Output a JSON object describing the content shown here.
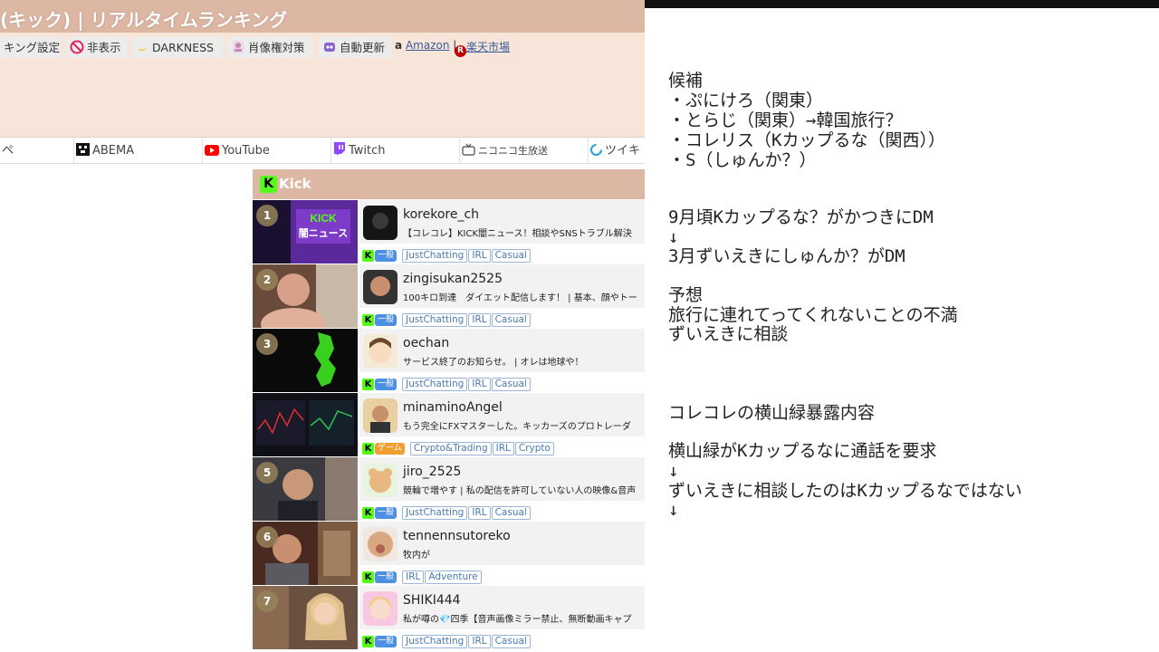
{
  "header": {
    "site_title": "(キック) | リアルタイムランキング"
  },
  "toolbar": {
    "ranking_settings": "キング設定",
    "hide": "非表示",
    "darkness": "DARKNESS",
    "portrait_rights": "肖像権対策",
    "auto_update": "自動更新",
    "amazon": "Amazon",
    "separator": "|",
    "rakuten": "楽天市場"
  },
  "platform_tabs": [
    "ペ",
    "ABEMA",
    "YouTube",
    "Twitch",
    "ニコニコ生放送",
    "ツイキ"
  ],
  "kick_panel": {
    "header_label": "Kick",
    "logo_letter": "K"
  },
  "ranking": [
    {
      "rank": "1",
      "username": "korekore_ch",
      "title": "【コレコレ】KICK闇ニュース！相談やSNSトラブル解決",
      "category": "一般",
      "category_color": "#4d8fe0",
      "tags": [
        "JustChatting",
        "IRL",
        "Casual"
      ]
    },
    {
      "rank": "2",
      "username": "zingisukan2525",
      "title": "100キロ到達　ダイエット配信します！ | 基本、顔やトー",
      "category": "一般",
      "category_color": "#4d8fe0",
      "tags": [
        "JustChatting",
        "IRL",
        "Casual"
      ]
    },
    {
      "rank": "3",
      "username": "oechan",
      "title": "サービス終了のお知らせ。 | オレは地球や！",
      "category": "一般",
      "category_color": "#4d8fe0",
      "tags": [
        "JustChatting",
        "IRL",
        "Casual"
      ]
    },
    {
      "rank": "4",
      "username": "minaminoAngel",
      "title": "もう完全にFXマスターした。キッカーズのプロトレーダ",
      "category": "ゲーム",
      "category_color": "#f0a030",
      "tags": [
        "Crypto&Trading",
        "IRL",
        "Crypto"
      ]
    },
    {
      "rank": "5",
      "username": "jiro_2525",
      "title": "競輪で増やす | 私の配信を許可していない人の映像&音声",
      "category": "一般",
      "category_color": "#4d8fe0",
      "tags": [
        "JustChatting",
        "IRL",
        "Casual"
      ]
    },
    {
      "rank": "6",
      "username": "tennennsutoreko",
      "title": "牧内が",
      "category": "一般",
      "category_color": "#4d8fe0",
      "tags": [
        "IRL",
        "Adventure"
      ]
    },
    {
      "rank": "7",
      "username": "SHIKI444",
      "title": "私が噂の💎四季【音声画像ミラー禁止、無断動画キャプ",
      "category": "一般",
      "category_color": "#4d8fe0",
      "tags": [
        "JustChatting",
        "IRL",
        "Casual"
      ]
    }
  ],
  "notes": {
    "lines": [
      "候補",
      "・ぷにけろ（関東）",
      "・とらじ（関東）→韓国旅行？",
      "・コレリス（Kカップるな（関西））",
      "・S（しゅんか？）",
      "9月頃Kカップるな？がかつきにDM",
      "↓",
      "3月ずいえきにしゅんか？がDM",
      "予想",
      "旅行に連れてってくれないことの不満",
      "ずいえきに相談",
      "コレコレの横山緑暴露内容",
      "横山緑がKカップるなに通話を要求",
      "↓",
      "ずいえきに相談したのはKカップるなではない",
      "↓"
    ]
  }
}
